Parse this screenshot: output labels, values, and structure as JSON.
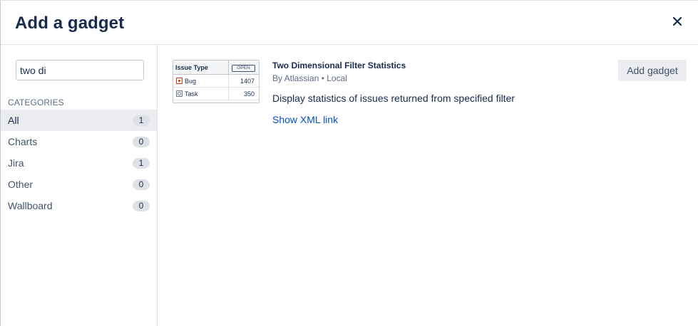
{
  "dialog": {
    "title": "Add a gadget",
    "close_icon": "close-icon"
  },
  "sidebar": {
    "search": {
      "value": "two di",
      "placeholder": ""
    },
    "categories_heading": "CATEGORIES",
    "categories": [
      {
        "label": "All",
        "count": "1",
        "active": true
      },
      {
        "label": "Charts",
        "count": "0",
        "active": false
      },
      {
        "label": "Jira",
        "count": "1",
        "active": false
      },
      {
        "label": "Other",
        "count": "0",
        "active": false
      },
      {
        "label": "Wallboard",
        "count": "0",
        "active": false
      }
    ]
  },
  "gadget": {
    "title": "Two Dimensional Filter Statistics",
    "meta": "By Atlassian • Local",
    "description": "Display statistics of issues returned from specified filter",
    "xml_link": "Show XML link",
    "add_button": "Add gadget",
    "thumbnail": {
      "header_label": "Issue Type",
      "header_badge": "OPEN",
      "rows": [
        {
          "label": "Bug",
          "value": "1407",
          "icon": "bug-icon"
        },
        {
          "label": "Task",
          "value": "350",
          "icon": "task-icon"
        }
      ]
    }
  },
  "colors": {
    "link": "#0052cc",
    "text": "#172b4d",
    "muted": "#5e6c84",
    "active_bg": "#ebecf0",
    "badge_bg": "#dfe1e6"
  }
}
